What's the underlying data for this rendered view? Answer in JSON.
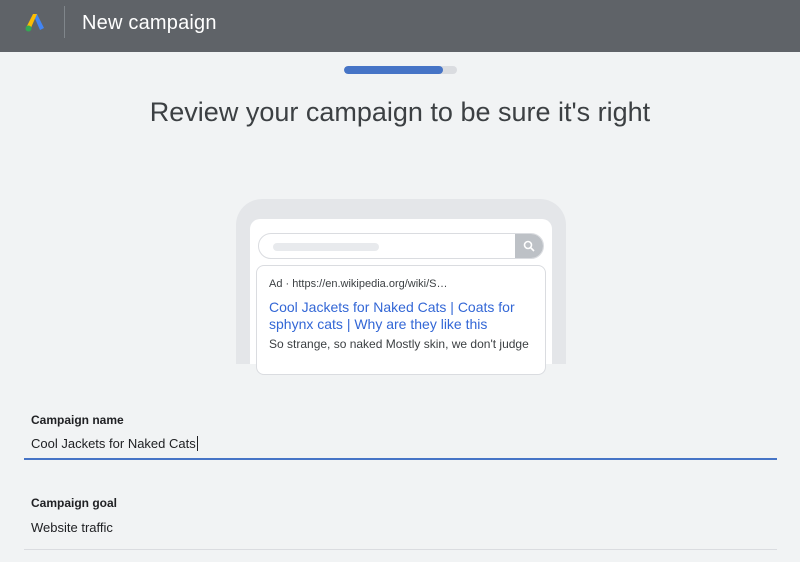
{
  "header": {
    "app_title": "New campaign",
    "logo_icon": "google-ads-logo",
    "background_color": "#5f6368"
  },
  "progress": {
    "fraction": 0.88,
    "color": "#4674c6"
  },
  "page": {
    "title": "Review your campaign to be sure it's right"
  },
  "preview": {
    "search_icon": "search-icon",
    "ad_line": "Ad · https://en.wikipedia.org/wiki/S…",
    "headline_line1": "Cool Jackets for Naked Cats | Coats for",
    "headline_line2": "sphynx cats | Why are they like this",
    "description": "So strange, so naked Mostly skin, we don't judge"
  },
  "form": {
    "campaign_name_label": "Campaign name",
    "campaign_name_value": "Cool Jackets for Naked Cats",
    "campaign_goal_label": "Campaign goal",
    "campaign_goal_value": "Website traffic"
  },
  "colors": {
    "accent": "#4674c6",
    "link": "#3367d6",
    "page_background": "#f1f3f4"
  }
}
